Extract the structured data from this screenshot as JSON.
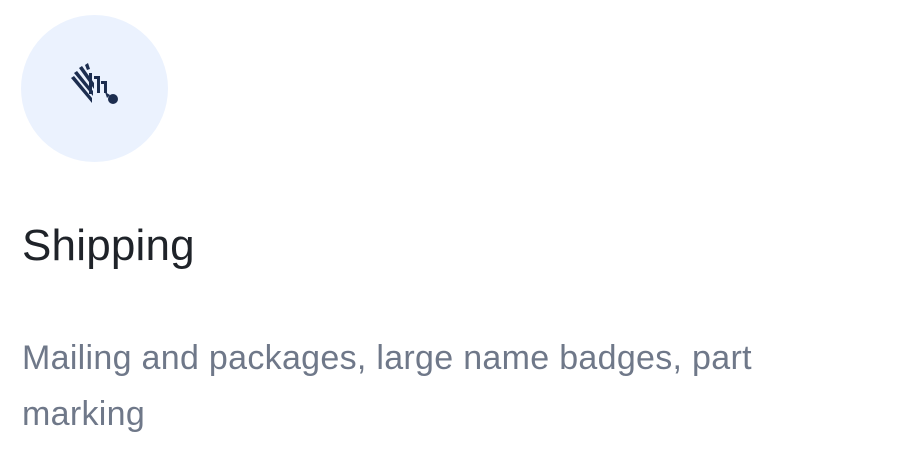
{
  "card": {
    "icon": "zebra-logo-icon",
    "title": "Shipping",
    "description": "Mailing and packages, large name badges, part marking"
  },
  "colors": {
    "icon_background": "#ebf2fe",
    "icon_color": "#1c2d4f",
    "title": "#1f2329",
    "description": "#6f7889"
  }
}
